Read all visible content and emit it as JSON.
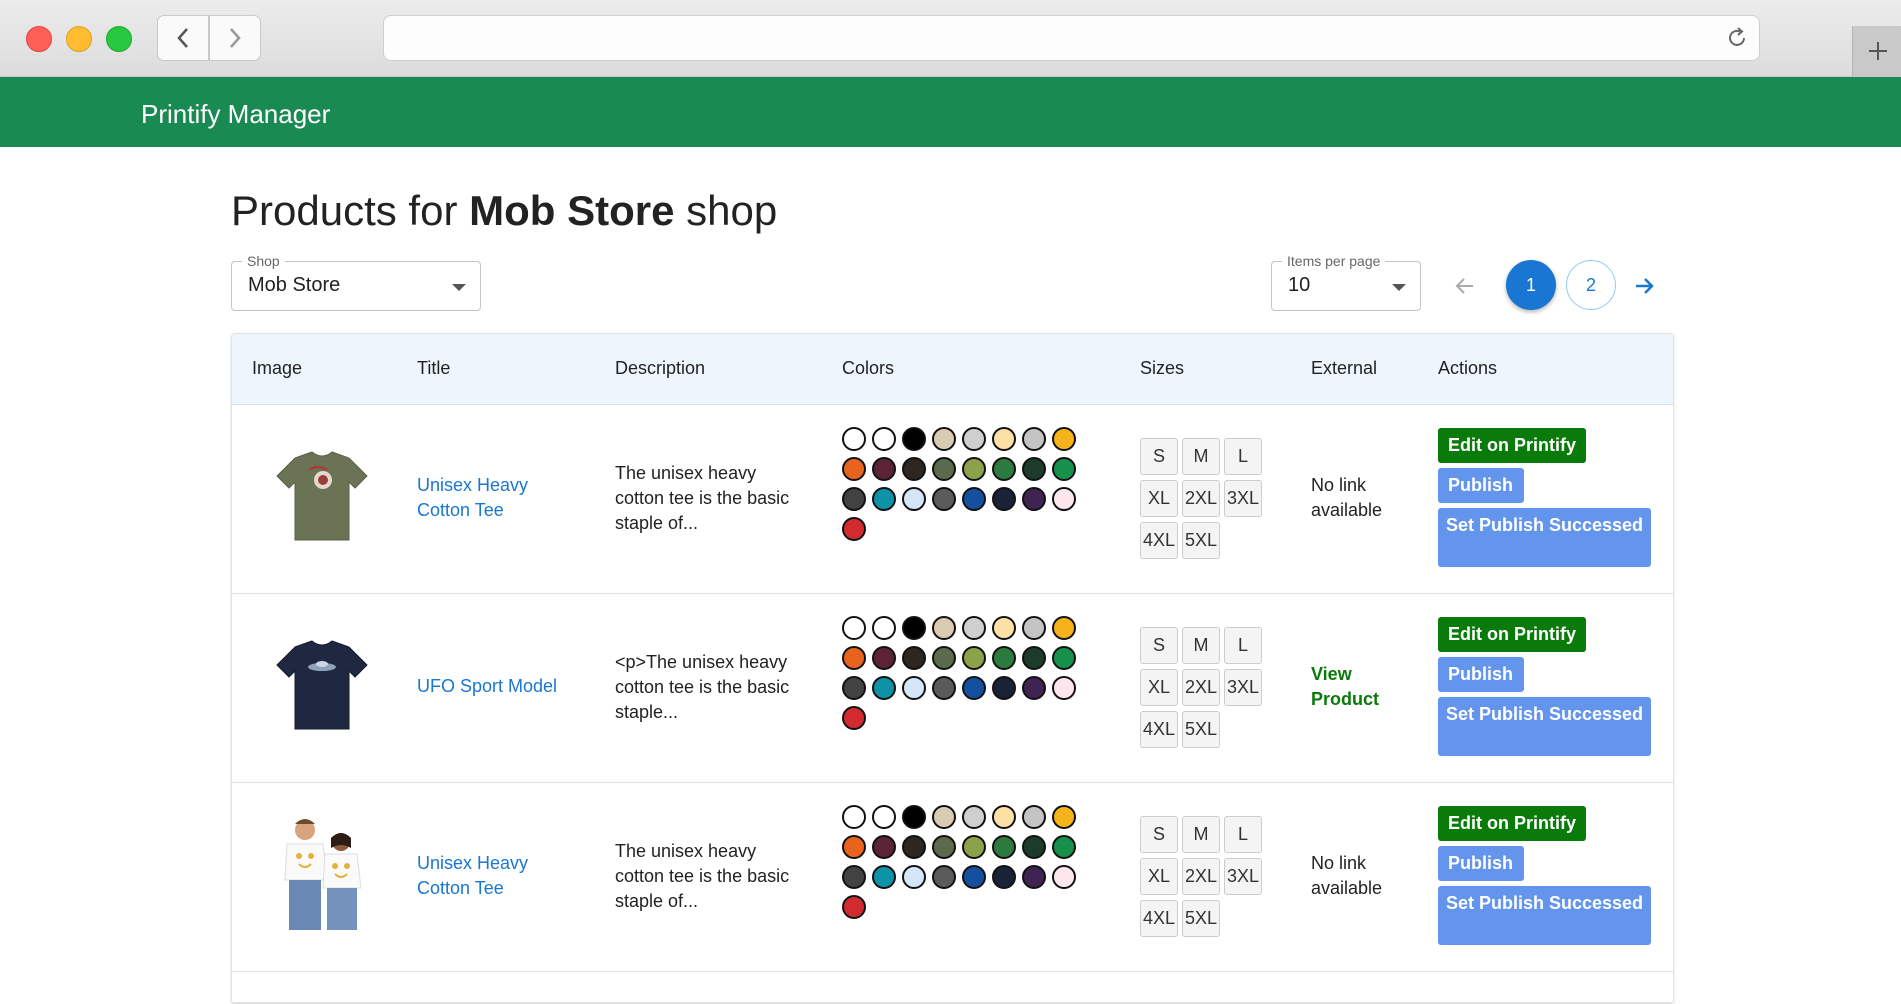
{
  "browser": {
    "url": ""
  },
  "app": {
    "brand": "Printify Manager"
  },
  "page": {
    "title_prefix": "Products for ",
    "title_shop": "Mob Store",
    "title_suffix": " shop"
  },
  "filters": {
    "shop_label": "Shop",
    "shop_value": "Mob Store",
    "ipp_label": "Items per page",
    "ipp_value": "10"
  },
  "pagination": {
    "pages": [
      "1",
      "2"
    ],
    "current": "1"
  },
  "table": {
    "headers": [
      "Image",
      "Title",
      "Description",
      "Colors",
      "Sizes",
      "External",
      "Actions"
    ],
    "rows": [
      {
        "title": "Unisex Heavy Cotton Tee",
        "description": "The unisex heavy cotton tee is the basic staple of...",
        "external": "No link available",
        "external_is_link": false,
        "image": "olive-tshirt-image"
      },
      {
        "title": "UFO Sport Model",
        "description": "<p>The unisex heavy cotton tee is the basic staple...",
        "external": "View Product",
        "external_is_link": true,
        "image": "navy-tshirt-image"
      },
      {
        "title": "Unisex Heavy Cotton Tee",
        "description": "The unisex heavy cotton tee is the basic staple of...",
        "external": "No link available",
        "external_is_link": false,
        "image": "couple-tshirt-image"
      }
    ],
    "colors": [
      "#ffffff",
      "#ffffff",
      "#000000",
      "#d9cbb3",
      "#cfcfcf",
      "#fce0a6",
      "#c4c4c4",
      "#f5b21b",
      "#e8631e",
      "#5b2333",
      "#2e2620",
      "#5c6a4c",
      "#8da04a",
      "#2d7a3e",
      "#1d3b2a",
      "#16904a",
      "#424242",
      "#0d93a5",
      "#d4e6f7",
      "#5a5a5a",
      "#14509e",
      "#1a2238",
      "#3f2352",
      "#fde6ec",
      "#d12a2f"
    ],
    "sizes": [
      "S",
      "M",
      "L",
      "XL",
      "2XL",
      "3XL",
      "4XL",
      "5XL"
    ],
    "actions": {
      "edit": "Edit on Printify",
      "publish": "Publish",
      "set_publish": "Set Publish Successed"
    }
  }
}
